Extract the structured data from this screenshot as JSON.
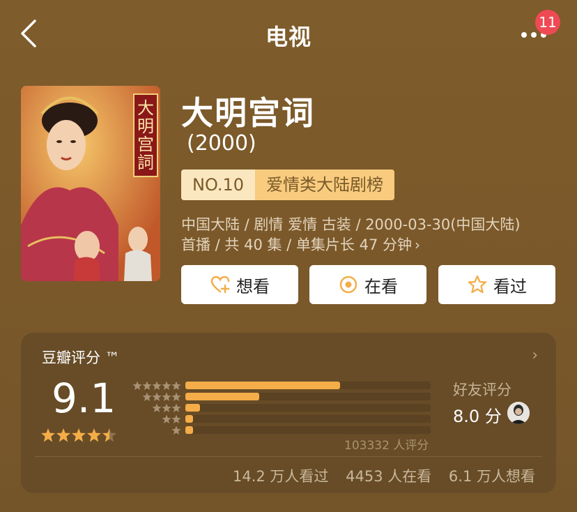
{
  "header": {
    "title": "电视",
    "badge_count": "11",
    "back_icon": "chevron-left-icon",
    "more_icon": "ellipsis-icon"
  },
  "movie": {
    "title": "大明宫词",
    "year": "(2000)",
    "rank_no": "NO.10",
    "rank_category": "爱情类大陆剧榜",
    "meta_line1": "中国大陆 / 剧情 爱情 古装 / 2000-03-30(中国大陆)",
    "meta_line2": "首播 / 共 40 集 / 单集片长 47 分钟",
    "poster_text": "大明宫詞"
  },
  "actions": {
    "want": "想看",
    "watching": "在看",
    "watched": "看过"
  },
  "rating": {
    "title": "豆瓣评分 ™",
    "score": "9.1",
    "stars_value": 4.5,
    "distribution_percent": [
      63,
      30,
      6,
      3,
      3
    ],
    "count_text": "103332 人评分",
    "friend_label": "好友评分",
    "friend_score": "8.0 分",
    "stats": {
      "watched": "14.2 万人看过",
      "watching": "4453 人在看",
      "want": "6.1 万人想看"
    }
  },
  "colors": {
    "accent": "#f4ad48",
    "badge": "#ef4a54",
    "background": "#7a5a2a",
    "card": "#674c27"
  }
}
